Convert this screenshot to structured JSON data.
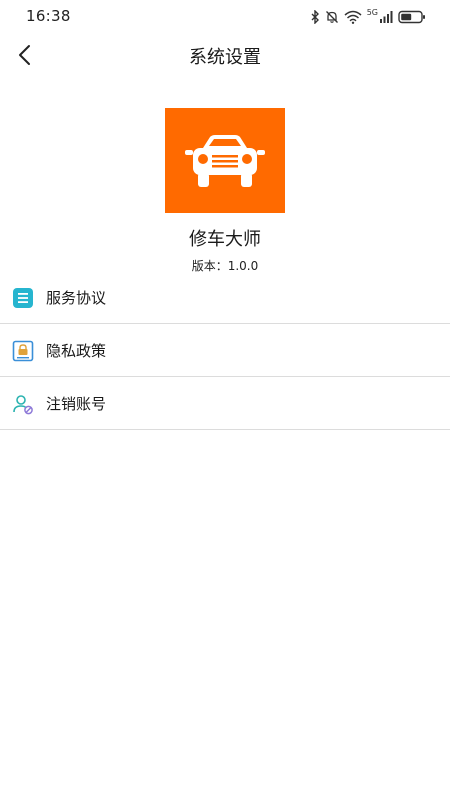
{
  "status_bar": {
    "time": "16:38",
    "network_label": "5G",
    "icons": [
      "bluetooth-icon",
      "mute-bell-icon",
      "wifi-icon",
      "cellular-signal-icon",
      "battery-icon"
    ]
  },
  "header": {
    "title": "系统设置",
    "back_icon": "chevron-left-icon"
  },
  "app": {
    "name": "修车大师",
    "version": "版本：1.0.0",
    "logo_icon": "car-icon",
    "logo_color": "#ff6a00"
  },
  "menu": {
    "items": [
      {
        "label": "服务协议",
        "icon": "document-list-icon",
        "icon_color": "#26b5cf"
      },
      {
        "label": "隐私政策",
        "icon": "privacy-lock-icon",
        "icon_color": "#3a8fd8"
      },
      {
        "label": "注销账号",
        "icon": "user-cancel-icon",
        "icon_color": "#2bb3b0"
      }
    ]
  }
}
